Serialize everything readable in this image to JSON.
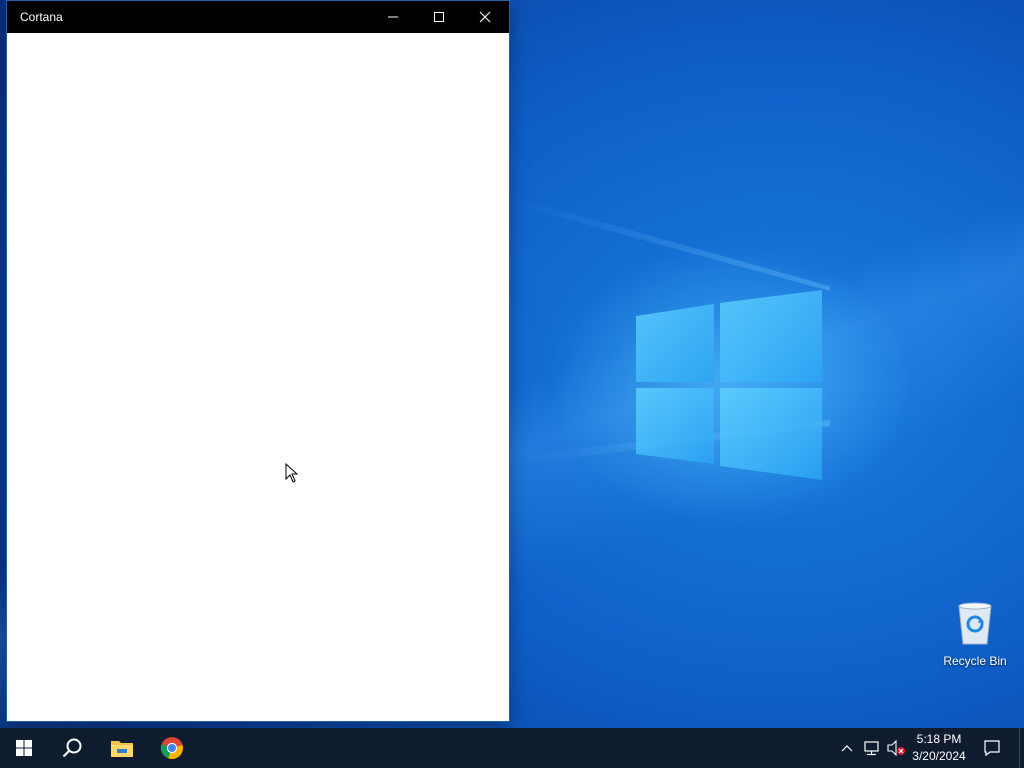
{
  "window": {
    "title": "Cortana",
    "controls": {
      "minimize_icon": "minimize-icon",
      "maximize_icon": "maximize-icon",
      "close_icon": "close-icon"
    }
  },
  "desktop": {
    "icons": [
      {
        "label": "Recycle Bin",
        "icon": "recycle-bin-icon"
      }
    ],
    "accent_color": "#0e5fc8"
  },
  "taskbar": {
    "pinned": [
      {
        "name": "Start",
        "icon": "windows-start-icon"
      },
      {
        "name": "Search",
        "icon": "search-icon"
      },
      {
        "name": "File Explorer",
        "icon": "folder-icon"
      },
      {
        "name": "Google Chrome",
        "icon": "chrome-icon"
      }
    ],
    "tray": {
      "time": "5:18 PM",
      "date": "3/20/2024",
      "icons": [
        "chevron-up-icon",
        "network-icon",
        "volume-muted-icon",
        "notification-icon"
      ]
    },
    "background": "#0f1b2e"
  }
}
